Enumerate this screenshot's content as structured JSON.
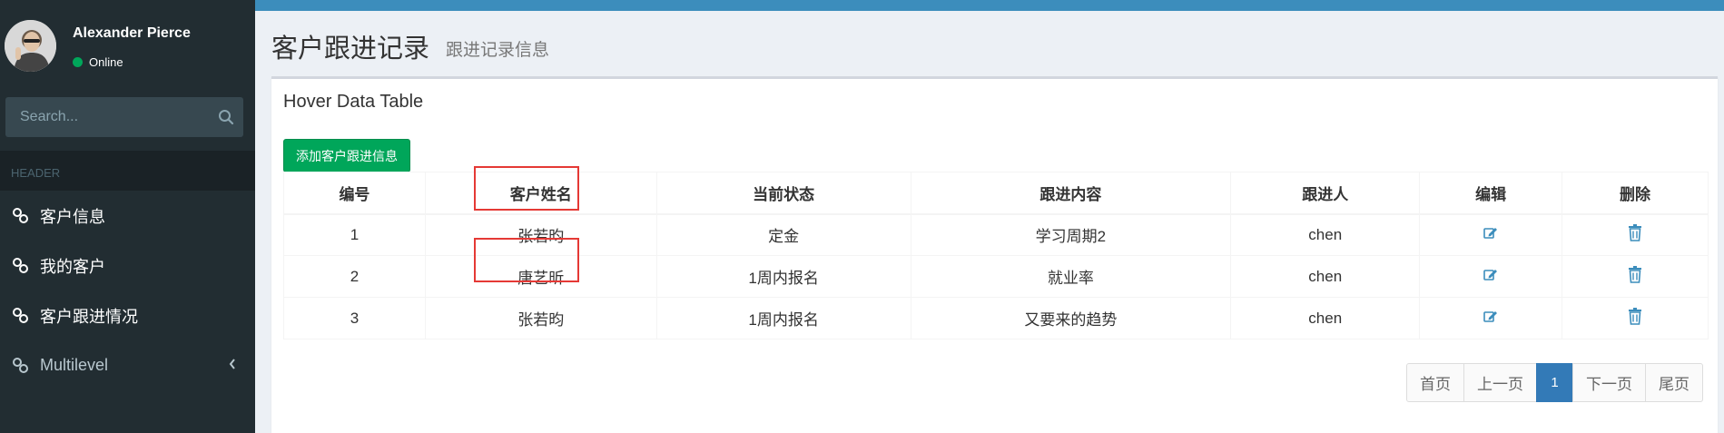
{
  "user": {
    "name": "Alexander Pierce",
    "status": "Online"
  },
  "search": {
    "placeholder": "Search..."
  },
  "sidebar": {
    "header": "HEADER",
    "items": [
      {
        "label": "客户信息",
        "icon": "link-icon"
      },
      {
        "label": "我的客户",
        "icon": "link-icon"
      },
      {
        "label": "客户跟进情况",
        "icon": "link-icon"
      },
      {
        "label": "Multilevel",
        "icon": "link-icon",
        "chevron": "chevron-left-icon"
      }
    ]
  },
  "page": {
    "title": "客户跟进记录",
    "subtitle": "跟进记录信息"
  },
  "box": {
    "title": "Hover Data Table",
    "add_button": "添加客户跟进信息"
  },
  "table": {
    "headers": [
      "编号",
      "客户姓名",
      "当前状态",
      "跟进内容",
      "跟进人",
      "编辑",
      "删除"
    ],
    "rows": [
      [
        "1",
        "张若昀",
        "定金",
        "学习周期2",
        "chen"
      ],
      [
        "2",
        "唐艺昕",
        "1周内报名",
        "就业率",
        "chen"
      ],
      [
        "3",
        "张若昀",
        "1周内报名",
        "又要来的趋势",
        "chen"
      ]
    ]
  },
  "pagination": {
    "first": "首页",
    "prev": "上一页",
    "current": "1",
    "next": "下一页",
    "last": "尾页"
  },
  "colors": {
    "sidebar": "#222d32",
    "topbar": "#3c8dbc",
    "add_button": "#00a65a",
    "active_page": "#337ab7",
    "highlight": "#e53935",
    "icon": "#3c8dbc"
  }
}
